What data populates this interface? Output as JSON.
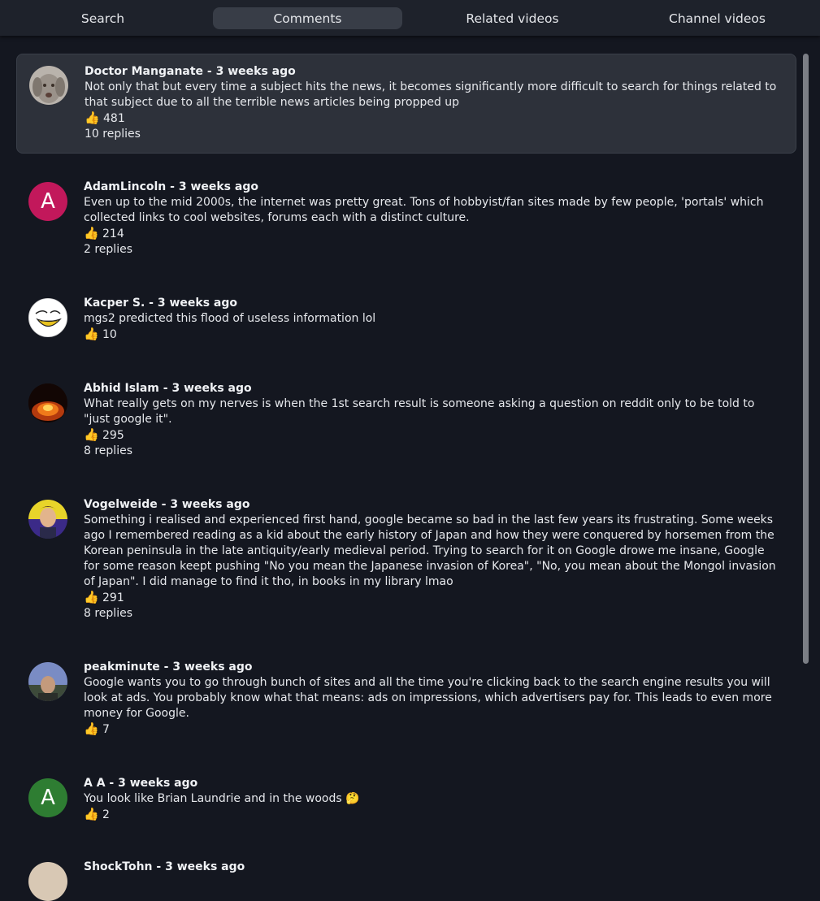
{
  "tabs": [
    {
      "label": "Search"
    },
    {
      "label": "Comments"
    },
    {
      "label": "Related videos"
    },
    {
      "label": "Channel videos"
    }
  ],
  "comments": [
    {
      "author": "Doctor Manganate",
      "time": "3 weeks ago",
      "text": "Not only that but every time a subject hits the news, it becomes significantly more difficult to search for things related to that subject due to all the terrible news articles being propped up",
      "likes": "481",
      "replies": "10 replies"
    },
    {
      "author": "AdamLincoln",
      "time": "3 weeks ago",
      "text": "Even up to the mid 2000s, the internet was pretty great. Tons of hobbyist/fan sites made by few people, 'portals' which collected links to cool websites, forums each with a distinct culture.",
      "likes": "214",
      "replies": "2 replies",
      "avatar_letter": "A",
      "avatar_color": "#c2185b"
    },
    {
      "author": "Kacper S.",
      "time": "3 weeks ago",
      "text": "mgs2 predicted this flood of useless information lol",
      "likes": "10"
    },
    {
      "author": "Abhid Islam",
      "time": "3 weeks ago",
      "text": "What really gets on my nerves is when the 1st search result is someone asking a question on reddit only to be told to \"just google it\".",
      "likes": "295",
      "replies": "8 replies"
    },
    {
      "author": "Vogelweide",
      "time": "3 weeks ago",
      "text": "Something i realised and experienced first hand, google became so bad in the last few years its frustrating. Some weeks ago I remembered reading as a kid about the early history of Japan and how they were conquered by horsemen from the Korean peninsula in the late antiquity/early medieval period. Trying to search for it on Google drowe me insane, Google for some reason keept pushing \"No you mean the Japanese invasion of Korea\", \"No, you mean about the Mongol invasion of Japan\". I did manage to find it tho, in books in my library lmao",
      "likes": "291",
      "replies": "8 replies"
    },
    {
      "author": "peakminute",
      "time": "3 weeks ago",
      "text": "Google wants you to go through bunch of sites and all the time you're clicking back to the search engine results you will look at ads. You probably know what that means: ads on impressions, which advertisers pay for. This leads to even more money for Google.",
      "likes": "7"
    },
    {
      "author": "A A",
      "time": "3 weeks ago",
      "text": "You look like Brian Laundrie and in the woods 🤔",
      "likes": "2",
      "avatar_letter": "A",
      "avatar_color": "#2e7d32"
    },
    {
      "author": "ShockTohn",
      "time": "3 weeks ago"
    }
  ],
  "icons": {
    "like": "thumbs-up-icon"
  },
  "colors": {
    "background": "#141720",
    "highlight": "#2d313a",
    "tab_active": "#383d47"
  }
}
